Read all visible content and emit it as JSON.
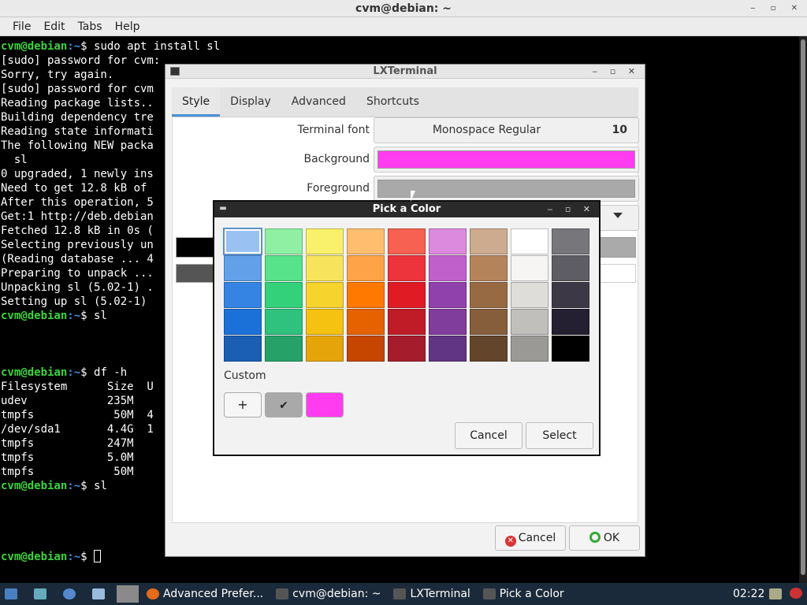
{
  "window": {
    "title": "cvm@debian: ~"
  },
  "menu": [
    "File",
    "Edit",
    "Tabs",
    "Help"
  ],
  "terminal": {
    "lines": [
      {
        "prompt": true,
        "cmd": " sudo apt install sl"
      },
      {
        "text": "[sudo] password for cvm:"
      },
      {
        "text": "Sorry, try again."
      },
      {
        "text": "[sudo] password for cvm"
      },
      {
        "text": "Reading package lists.."
      },
      {
        "text": "Building dependency tre"
      },
      {
        "text": "Reading state informati"
      },
      {
        "text": "The following NEW packa"
      },
      {
        "text": "  sl"
      },
      {
        "text": "0 upgraded, 1 newly ins"
      },
      {
        "text": "Need to get 12.8 kB of "
      },
      {
        "text": "After this operation, 5"
      },
      {
        "text": "Get:1 http://deb.debian"
      },
      {
        "text": "Fetched 12.8 kB in 0s ("
      },
      {
        "text": "Selecting previously un"
      },
      {
        "text": "(Reading database ... 4"
      },
      {
        "text": "Preparing to unpack ..."
      },
      {
        "text": "Unpacking sl (5.02-1) ."
      },
      {
        "text": "Setting up sl (5.02-1) "
      },
      {
        "prompt": true,
        "cmd": " sl"
      },
      {
        "text": ""
      },
      {
        "text": ""
      },
      {
        "text": ""
      },
      {
        "prompt": true,
        "cmd": " df -h"
      },
      {
        "text": "Filesystem      Size  U"
      },
      {
        "text": "udev            235M   "
      },
      {
        "text": "tmpfs            50M  4"
      },
      {
        "text": "/dev/sda1       4.4G  1"
      },
      {
        "text": "tmpfs           247M   "
      },
      {
        "text": "tmpfs           5.0M   "
      },
      {
        "text": "tmpfs            50M   "
      },
      {
        "prompt": true,
        "cmd": " sl"
      },
      {
        "text": ""
      },
      {
        "text": ""
      },
      {
        "text": ""
      },
      {
        "text": ""
      },
      {
        "prompt": true,
        "cmd": " ",
        "cursor": true
      }
    ],
    "prompt_user": "cvm@debian",
    "prompt_path": ":~",
    "prompt_symbol": "$"
  },
  "prefs": {
    "title": "LXTerminal",
    "tabs": [
      "Style",
      "Display",
      "Advanced",
      "Shortcuts"
    ],
    "active_tab": "Style",
    "terminal_font_label": "Terminal font",
    "font_name": "Monospace Regular",
    "font_size": "10",
    "background_label": "Background",
    "background_color": "#ff3cef",
    "foreground_label": "Foreground",
    "foreground_color": "#a9a9a9",
    "cancel_label": "Cancel",
    "ok_label": "OK"
  },
  "picker": {
    "title": "Pick a Color",
    "palette": [
      [
        "#99c1f1",
        "#8ff0a4",
        "#f9f06b",
        "#ffbe6f",
        "#f66151",
        "#dc8add",
        "#cdab8f",
        "#ffffff",
        "#77767b"
      ],
      [
        "#62a0ea",
        "#57e389",
        "#f8e45c",
        "#ffa348",
        "#ed333b",
        "#c061cb",
        "#b5835a",
        "#f6f5f4",
        "#5e5c64"
      ],
      [
        "#3584e4",
        "#33d17a",
        "#f6d32d",
        "#ff7800",
        "#e01b24",
        "#9141ac",
        "#986a44",
        "#deddda",
        "#3d3846"
      ],
      [
        "#1c71d8",
        "#2ec27e",
        "#f5c211",
        "#e66100",
        "#c01c28",
        "#813d9c",
        "#865e3c",
        "#c0bfbc",
        "#241f31"
      ],
      [
        "#1a5fb4",
        "#26a269",
        "#e5a50a",
        "#c64600",
        "#a51d2d",
        "#613583",
        "#63452c",
        "#9a9996",
        "#000000"
      ]
    ],
    "custom_label": "Custom",
    "custom_colors": [
      "#a9a9a9",
      "#ff3cef"
    ],
    "cancel_label": "Cancel",
    "select_label": "Select"
  },
  "taskbar": {
    "items": [
      "Advanced Prefer...",
      "cvm@debian: ~",
      "LXTerminal",
      "Pick a Color"
    ],
    "clock": "02:22"
  }
}
